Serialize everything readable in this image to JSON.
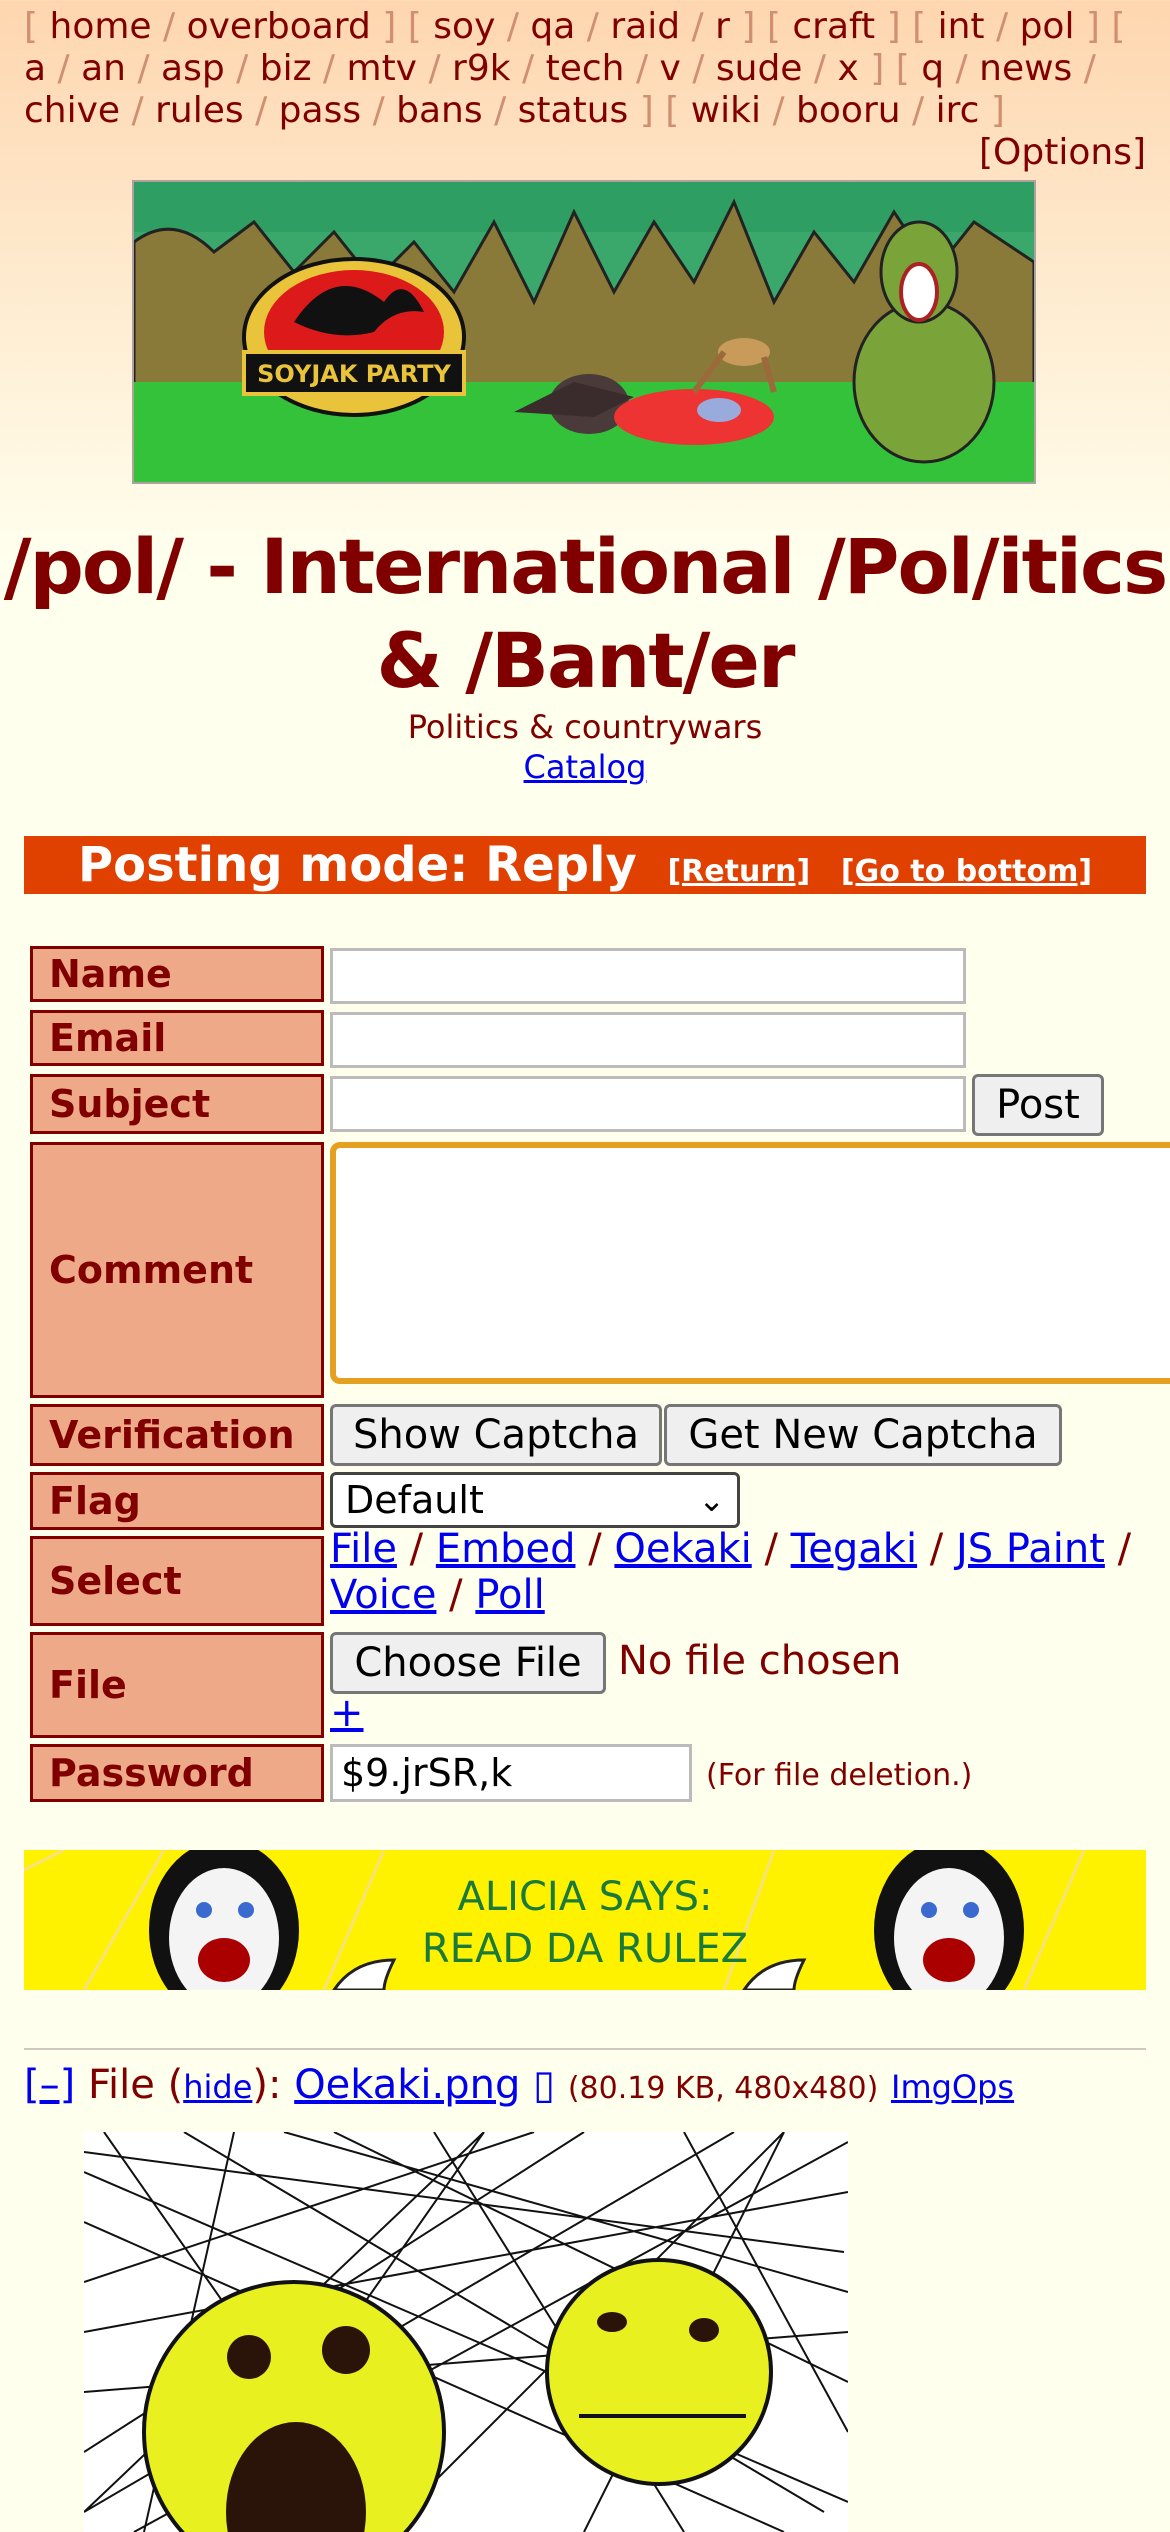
{
  "boardlist": {
    "line1": [
      "home",
      "overboard",
      "soy",
      "qa",
      "raid",
      "r",
      "craft",
      "int",
      "pol"
    ],
    "line2": [
      "a",
      "an",
      "asp",
      "biz",
      "mtv",
      "r9k",
      "tech",
      "v",
      "sude",
      "x",
      "q",
      "news"
    ],
    "line3": [
      "chive",
      "rules",
      "pass",
      "bans",
      "status",
      "wiki",
      "booru",
      "irc"
    ],
    "options": "[Options]"
  },
  "banner": {
    "logo_text": "SOYJAK PARTY"
  },
  "board": {
    "title_line1": "/pol/ - International /Pol/itics",
    "title_line2": "& /Bant/er",
    "subtitle": "Politics & countrywars",
    "catalog": "Catalog"
  },
  "mode": {
    "label": "Posting mode: Reply",
    "return": "[Return]",
    "bottom": "[Go to bottom]"
  },
  "form": {
    "name_label": "Name",
    "email_label": "Email",
    "subject_label": "Subject",
    "post_button": "Post",
    "comment_label": "Comment",
    "verification_label": "Verification",
    "show_captcha": "Show Captcha",
    "new_captcha": "Get New Captcha",
    "flag_label": "Flag",
    "flag_value": "Default",
    "select_label": "Select",
    "select_options": [
      "File",
      "Embed",
      "Oekaki",
      "Tegaki",
      "JS Paint",
      "Voice",
      "Poll"
    ],
    "file_label": "File",
    "choose_file": "Choose File",
    "no_file": "No file chosen",
    "add_file": "+",
    "password_label": "Password",
    "password_value": "$9.jrSR,k",
    "password_note": "(For file deletion.)"
  },
  "ad": {
    "line1": "ALICIA SAYS:",
    "line2": "READ DA RULEZ"
  },
  "post": {
    "collapse": "[–]",
    "file_prefix": "File (",
    "hide": "hide",
    "file_mid": "):",
    "filename": "Oekaki.png",
    "meta": "(80.19 KB, 480x480)",
    "imgops": "ImgOps"
  },
  "colors": {
    "maroon": "#800000",
    "label_bg": "#eeaa88",
    "mode_bar": "#e04000",
    "link": "#0000ee",
    "focus_border": "#e6a020"
  }
}
